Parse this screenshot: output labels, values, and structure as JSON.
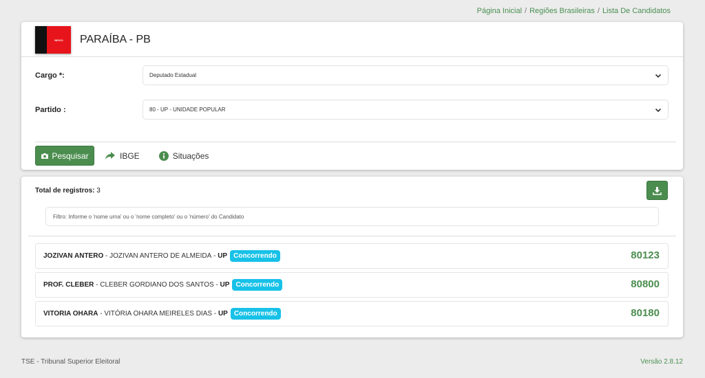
{
  "breadcrumb": [
    "Página Inicial",
    "Regiões Brasileiras",
    "Lista De Candidatos"
  ],
  "state": {
    "title": "PARAÍBA - PB",
    "flag_text": "NEGO",
    "flag_colors": [
      "#111111",
      "#e8141b"
    ]
  },
  "filters": {
    "cargo_label": "Cargo *:",
    "cargo_value": "Deputado Estadual",
    "partido_label": "Partido :",
    "partido_value": "80 - UP - UNIDADE POPULAR"
  },
  "toolbar": {
    "search_label": "Pesquisar",
    "ibge_label": "IBGE",
    "situacoes_label": "Situações"
  },
  "results": {
    "total_label": "Total de registros:",
    "total_value": "3",
    "filter_placeholder": "Filtro: Informe o 'nome urna' ou o 'nome completo' ou o 'número' do Candidato",
    "candidates": [
      {
        "urn_name": "JOZIVAN ANTERO",
        "full_name": "JOZIVAN ANTERO DE ALMEIDA",
        "party": "UP",
        "status": "Concorrendo",
        "number": "80123"
      },
      {
        "urn_name": "PROF. CLEBER",
        "full_name": "CLEBER GORDIANO DOS SANTOS",
        "party": "UP",
        "status": "Concorrendo",
        "number": "80800"
      },
      {
        "urn_name": "VITORIA OHARA",
        "full_name": "VITÓRIA OHARA MEIRELES DIAS",
        "party": "UP",
        "status": "Concorrendo",
        "number": "80180"
      }
    ]
  },
  "footer": {
    "left": "TSE - Tribunal Superior Eleitoral",
    "right": "Versão 2.8.12"
  },
  "colors": {
    "accent": "#4b8d4f",
    "badge": "#17c1e8"
  }
}
